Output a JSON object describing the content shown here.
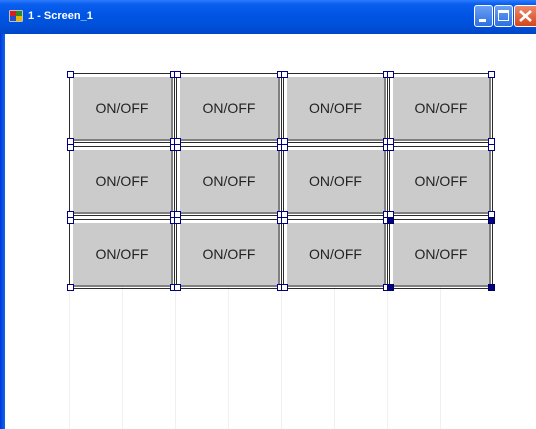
{
  "window": {
    "title": "1 - Screen_1",
    "icon": "app-screen-icon",
    "controls": [
      "minimize-icon",
      "maximize-icon",
      "close-icon"
    ],
    "title_color": "#0054e3"
  },
  "buttons": {
    "rows": [
      [
        {
          "label": "ON/OFF",
          "selected": false
        },
        {
          "label": "ON/OFF",
          "selected": false
        },
        {
          "label": "ON/OFF",
          "selected": false
        },
        {
          "label": "ON/OFF",
          "selected": false
        }
      ],
      [
        {
          "label": "ON/OFF",
          "selected": false
        },
        {
          "label": "ON/OFF",
          "selected": false
        },
        {
          "label": "ON/OFF",
          "selected": false
        },
        {
          "label": "ON/OFF",
          "selected": false
        }
      ],
      [
        {
          "label": "ON/OFF",
          "selected": false
        },
        {
          "label": "ON/OFF",
          "selected": false
        },
        {
          "label": "ON/OFF",
          "selected": false
        },
        {
          "label": "ON/OFF",
          "selected": true
        }
      ]
    ],
    "face_color": "#cbcbcb",
    "handle_color": "#000080"
  }
}
